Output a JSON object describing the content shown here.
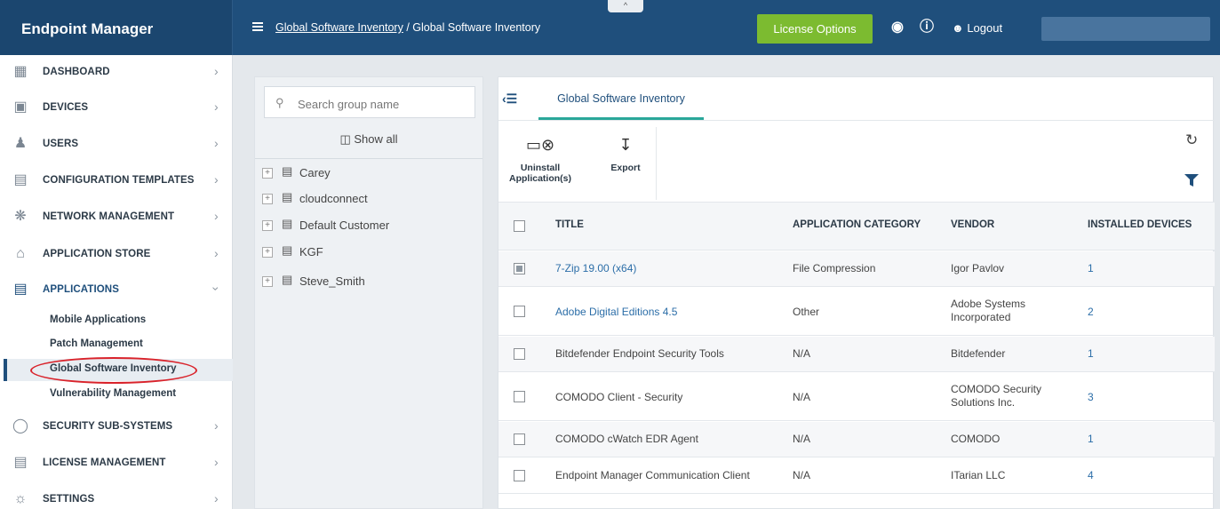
{
  "header": {
    "brand": "Endpoint Manager",
    "breadcrumb_link": "Global Software Inventory",
    "breadcrumb_sep": "/",
    "breadcrumb_current": "Global Software Inventory",
    "collapse_glyph": "^",
    "license_button": "License Options",
    "logout": "Logout"
  },
  "sidebar": {
    "items": [
      {
        "label": "DASHBOARD",
        "icon": "dashboard-icon"
      },
      {
        "label": "DEVICES",
        "icon": "devices-icon"
      },
      {
        "label": "USERS",
        "icon": "users-icon"
      },
      {
        "label": "CONFIGURATION TEMPLATES",
        "icon": "templates-icon"
      },
      {
        "label": "NETWORK MANAGEMENT",
        "icon": "network-icon"
      },
      {
        "label": "APPLICATION STORE",
        "icon": "store-icon"
      },
      {
        "label": "APPLICATIONS",
        "icon": "applications-icon"
      },
      {
        "label": "SECURITY SUB-SYSTEMS",
        "icon": "shield-icon"
      },
      {
        "label": "LICENSE MANAGEMENT",
        "icon": "license-icon"
      },
      {
        "label": "SETTINGS",
        "icon": "gear-icon"
      }
    ],
    "sub_items": [
      "Mobile Applications",
      "Patch Management",
      "Global Software Inventory",
      "Vulnerability Management"
    ]
  },
  "groups": {
    "search_placeholder": "Search group name",
    "show_all": "Show all",
    "items": [
      "Carey",
      "cloudconnect",
      "Default Customer",
      "KGF",
      "Steve_Smith"
    ]
  },
  "main": {
    "tab": "Global Software Inventory",
    "toolbar": {
      "uninstall_line1": "Uninstall",
      "uninstall_line2": "Application(s)",
      "export": "Export"
    },
    "columns": {
      "title": "TITLE",
      "category": "APPLICATION CATEGORY",
      "vendor": "VENDOR",
      "devices": "INSTALLED DEVICES"
    },
    "rows": [
      {
        "title": "7-Zip 19.00 (x64)",
        "category": "File Compression",
        "vendor": "Igor Pavlov",
        "vendor2": "",
        "devices": "1"
      },
      {
        "title": "Adobe Digital Editions 4.5",
        "category": "Other",
        "vendor": "Adobe Systems",
        "vendor2": "Incorporated",
        "devices": "2"
      },
      {
        "title": "Bitdefender Endpoint Security Tools",
        "category": "N/A",
        "vendor": "Bitdefender",
        "vendor2": "",
        "devices": "1"
      },
      {
        "title": "COMODO Client - Security",
        "category": "N/A",
        "vendor": "COMODO Security",
        "vendor2": "Solutions Inc.",
        "devices": "3"
      },
      {
        "title": "COMODO cWatch EDR Agent",
        "category": "N/A",
        "vendor": "COMODO",
        "vendor2": "",
        "devices": "1"
      },
      {
        "title": "Endpoint Manager Communication Client",
        "category": "N/A",
        "vendor": "ITarian LLC",
        "vendor2": "",
        "devices": "4"
      }
    ]
  },
  "colors": {
    "header_bg": "#1f4f7c",
    "license_green": "#7cbb30",
    "tab_accent": "#2aa79a",
    "link_blue": "#2c6ea8",
    "annotation_red": "#d9232b"
  }
}
